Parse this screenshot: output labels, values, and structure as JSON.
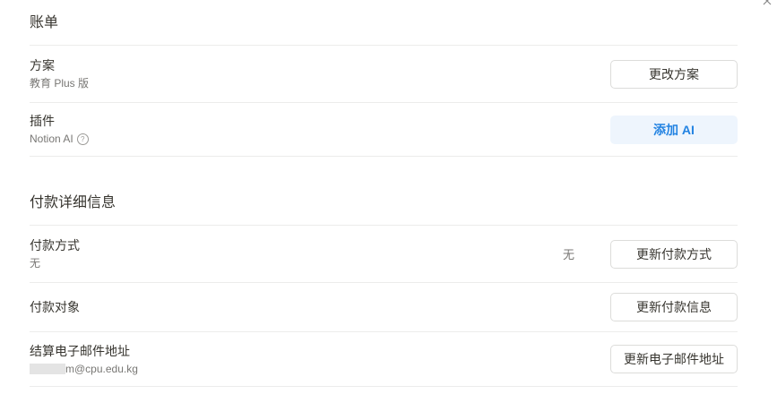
{
  "billing": {
    "title": "账单",
    "plan": {
      "label": "方案",
      "value": "教育 Plus 版",
      "button": "更改方案"
    },
    "addon": {
      "label": "插件",
      "value": "Notion AI",
      "button": "添加 AI"
    }
  },
  "payment": {
    "title": "付款详细信息",
    "method": {
      "label": "付款方式",
      "value": "无",
      "right_value": "无",
      "button": "更新付款方式"
    },
    "billed_to": {
      "label": "付款对象",
      "button": "更新付款信息"
    },
    "email": {
      "label": "结算电子邮件地址",
      "value": "m@cpu.edu.kg",
      "button": "更新电子邮件地址"
    }
  },
  "colors": {
    "accent": "#2383e2",
    "accent_bg": "#eef5fd",
    "divider": "#ececeb",
    "text": "#37352f",
    "muted": "#787774"
  },
  "icons": {
    "close": "close-icon",
    "help": "help-circle-icon"
  }
}
